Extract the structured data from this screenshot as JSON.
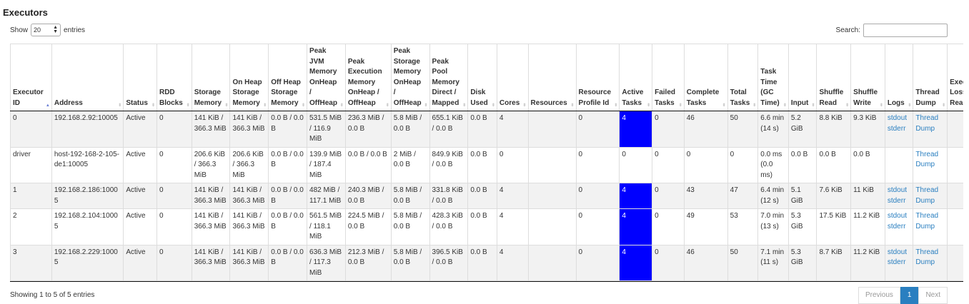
{
  "title": "Executors",
  "length": {
    "prefix": "Show",
    "value": "20",
    "suffix": "entries"
  },
  "search": {
    "label": "Search:"
  },
  "columns": [
    {
      "label": "Executor ID",
      "sort": "asc"
    },
    {
      "label": "Address"
    },
    {
      "label": "Status"
    },
    {
      "label": "RDD Blocks"
    },
    {
      "label": "Storage Memory"
    },
    {
      "label": "On Heap Storage Memory"
    },
    {
      "label": "Off Heap Storage Memory"
    },
    {
      "label": "Peak JVM Memory OnHeap / OffHeap"
    },
    {
      "label": "Peak Execution Memory OnHeap / OffHeap"
    },
    {
      "label": "Peak Storage Memory OnHeap / OffHeap"
    },
    {
      "label": "Peak Pool Memory Direct / Mapped"
    },
    {
      "label": "Disk Used"
    },
    {
      "label": "Cores"
    },
    {
      "label": "Resources"
    },
    {
      "label": "Resource Profile Id"
    },
    {
      "label": "Active Tasks"
    },
    {
      "label": "Failed Tasks"
    },
    {
      "label": "Complete Tasks"
    },
    {
      "label": "Total Tasks"
    },
    {
      "label": "Task Time (GC Time)"
    },
    {
      "label": "Input"
    },
    {
      "label": "Shuffle Read"
    },
    {
      "label": "Shuffle Write"
    },
    {
      "label": "Logs"
    },
    {
      "label": "Thread Dump"
    },
    {
      "label": "Exec Loss Reason"
    }
  ],
  "rows": [
    {
      "executor_id": "0",
      "address": "192.168.2.92:10005",
      "status": "Active",
      "rdd_blocks": "0",
      "storage_memory": "141 KiB / 366.3 MiB",
      "on_heap": "141 KiB / 366.3 MiB",
      "off_heap": "0.0 B / 0.0 B",
      "peak_jvm": "531.5 MiB / 116.9 MiB",
      "peak_exec": "236.3 MiB / 0.0 B",
      "peak_storage": "5.8 MiB / 0.0 B",
      "peak_pool": "655.1 KiB / 0.0 B",
      "disk_used": "0.0 B",
      "cores": "4",
      "resources": "",
      "resource_profile_id": "0",
      "active_tasks": "4",
      "failed_tasks": "0",
      "complete_tasks": "46",
      "total_tasks": "50",
      "task_time": "6.6 min (14 s)",
      "input": "5.2 GiB",
      "shuffle_read": "8.8 KiB",
      "shuffle_write": "9.3 KiB",
      "logs": [
        "stdout",
        "stderr"
      ],
      "thread_dump": "Thread Dump",
      "loss_reason": "",
      "active": true
    },
    {
      "executor_id": "driver",
      "address": "host-192-168-2-105-de1:10005",
      "status": "Active",
      "rdd_blocks": "0",
      "storage_memory": "206.6 KiB / 366.3 MiB",
      "on_heap": "206.6 KiB / 366.3 MiB",
      "off_heap": "0.0 B / 0.0 B",
      "peak_jvm": "139.9 MiB / 187.4 MiB",
      "peak_exec": "0.0 B / 0.0 B",
      "peak_storage": "2 MiB / 0.0 B",
      "peak_pool": "849.9 KiB / 0.0 B",
      "disk_used": "0.0 B",
      "cores": "0",
      "resources": "",
      "resource_profile_id": "0",
      "active_tasks": "0",
      "failed_tasks": "0",
      "complete_tasks": "0",
      "total_tasks": "0",
      "task_time": "0.0 ms (0.0 ms)",
      "input": "0.0 B",
      "shuffle_read": "0.0 B",
      "shuffle_write": "0.0 B",
      "logs": [],
      "thread_dump": "Thread Dump",
      "loss_reason": "",
      "active": false
    },
    {
      "executor_id": "1",
      "address": "192.168.2.186:10005",
      "status": "Active",
      "rdd_blocks": "0",
      "storage_memory": "141 KiB / 366.3 MiB",
      "on_heap": "141 KiB / 366.3 MiB",
      "off_heap": "0.0 B / 0.0 B",
      "peak_jvm": "482 MiB / 117.1 MiB",
      "peak_exec": "240.3 MiB / 0.0 B",
      "peak_storage": "5.8 MiB / 0.0 B",
      "peak_pool": "331.8 KiB / 0.0 B",
      "disk_used": "0.0 B",
      "cores": "4",
      "resources": "",
      "resource_profile_id": "0",
      "active_tasks": "4",
      "failed_tasks": "0",
      "complete_tasks": "43",
      "total_tasks": "47",
      "task_time": "6.4 min (12 s)",
      "input": "5.1 GiB",
      "shuffle_read": "7.6 KiB",
      "shuffle_write": "11 KiB",
      "logs": [
        "stdout",
        "stderr"
      ],
      "thread_dump": "Thread Dump",
      "loss_reason": "",
      "active": true
    },
    {
      "executor_id": "2",
      "address": "192.168.2.104:10005",
      "status": "Active",
      "rdd_blocks": "0",
      "storage_memory": "141 KiB / 366.3 MiB",
      "on_heap": "141 KiB / 366.3 MiB",
      "off_heap": "0.0 B / 0.0 B",
      "peak_jvm": "561.5 MiB / 118.1 MiB",
      "peak_exec": "224.5 MiB / 0.0 B",
      "peak_storage": "5.8 MiB / 0.0 B",
      "peak_pool": "428.3 KiB / 0.0 B",
      "disk_used": "0.0 B",
      "cores": "4",
      "resources": "",
      "resource_profile_id": "0",
      "active_tasks": "4",
      "failed_tasks": "0",
      "complete_tasks": "49",
      "total_tasks": "53",
      "task_time": "7.0 min (13 s)",
      "input": "5.3 GiB",
      "shuffle_read": "17.5 KiB",
      "shuffle_write": "11.2 KiB",
      "logs": [
        "stdout",
        "stderr"
      ],
      "thread_dump": "Thread Dump",
      "loss_reason": "",
      "active": true
    },
    {
      "executor_id": "3",
      "address": "192.168.2.229:10005",
      "status": "Active",
      "rdd_blocks": "0",
      "storage_memory": "141 KiB / 366.3 MiB",
      "on_heap": "141 KiB / 366.3 MiB",
      "off_heap": "0.0 B / 0.0 B",
      "peak_jvm": "636.3 MiB / 117.3 MiB",
      "peak_exec": "212.3 MiB / 0.0 B",
      "peak_storage": "5.8 MiB / 0.0 B",
      "peak_pool": "396.5 KiB / 0.0 B",
      "disk_used": "0.0 B",
      "cores": "4",
      "resources": "",
      "resource_profile_id": "0",
      "active_tasks": "4",
      "failed_tasks": "0",
      "complete_tasks": "46",
      "total_tasks": "50",
      "task_time": "7.1 min (11 s)",
      "input": "5.3 GiB",
      "shuffle_read": "8.7 KiB",
      "shuffle_write": "11.2 KiB",
      "logs": [
        "stdout",
        "stderr"
      ],
      "thread_dump": "Thread Dump",
      "loss_reason": "",
      "active": true
    }
  ],
  "info": "Showing 1 to 5 of 5 entries",
  "pagination": {
    "previous": "Previous",
    "page": "1",
    "next": "Next"
  },
  "colors": {
    "active_tasks_bg": "#0000ff",
    "link": "#2a7fc0",
    "row_stripe": "#f2f2f2"
  }
}
